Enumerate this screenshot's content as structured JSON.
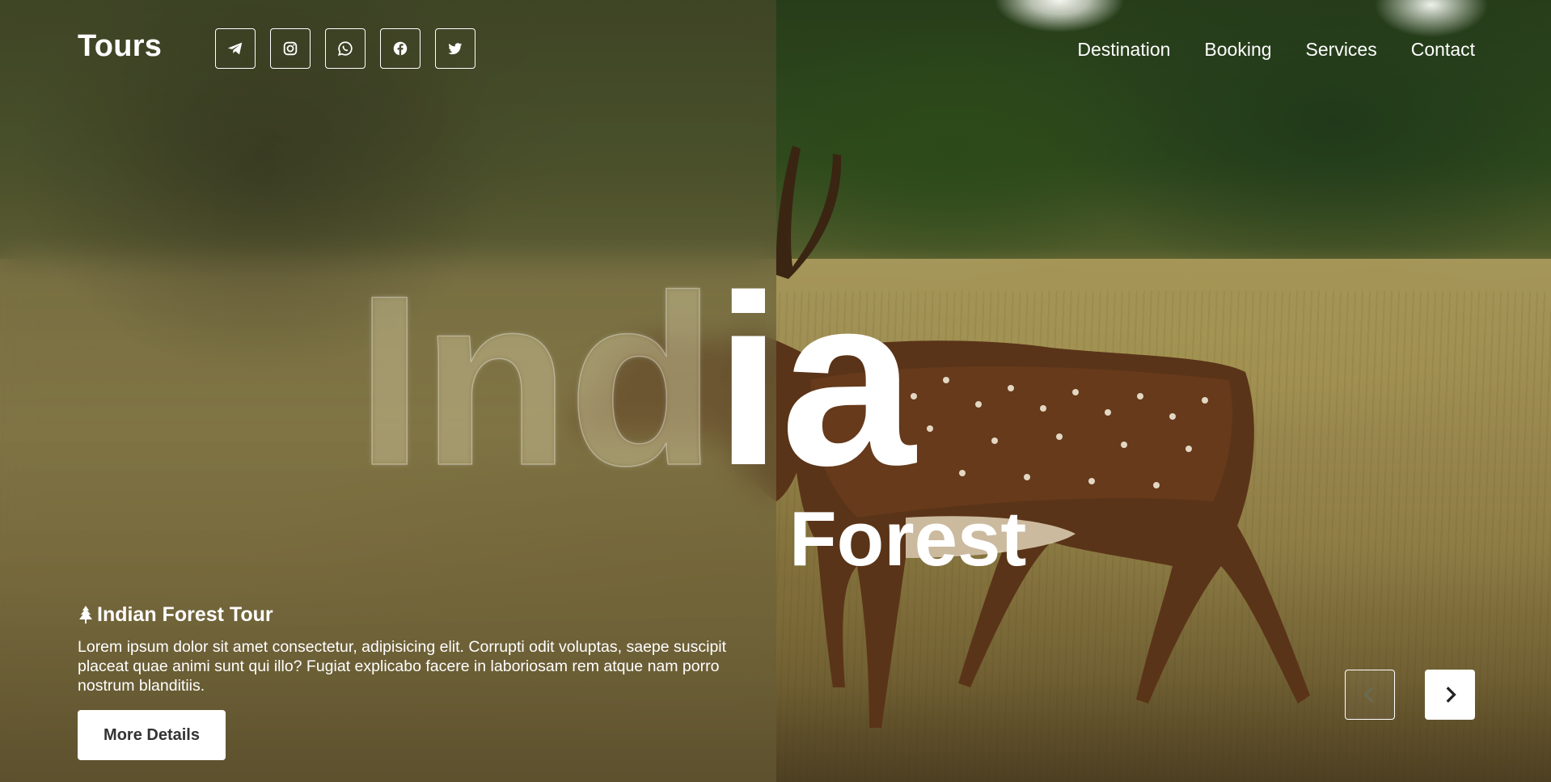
{
  "header": {
    "brand": "Tours",
    "socials": [
      {
        "icon": "telegram-icon"
      },
      {
        "icon": "instagram-icon"
      },
      {
        "icon": "whatsapp-icon"
      },
      {
        "icon": "facebook-icon"
      },
      {
        "icon": "twitter-icon"
      }
    ],
    "nav": [
      "Destination",
      "Booking",
      "Services",
      "Contact"
    ]
  },
  "hero": {
    "word_ghost": "Ind",
    "word_solid": "ia",
    "subtitle": "Forest"
  },
  "tour": {
    "icon": "tree-icon",
    "title": "Indian Forest Tour",
    "description": "Lorem ipsum dolor sit amet consectetur, adipisicing elit. Corrupti odit voluptas, saepe suscipit placeat quae animi sunt qui illo? Fugiat explicabo facere in laboriosam rem atque nam porro nostrum blanditiis.",
    "button": "More Details"
  },
  "carousel": {
    "prev_icon": "chevron-left-icon",
    "next_icon": "chevron-right-icon"
  },
  "colors": {
    "text": "#ffffff",
    "button_bg": "#ffffff",
    "button_text": "#333333"
  }
}
